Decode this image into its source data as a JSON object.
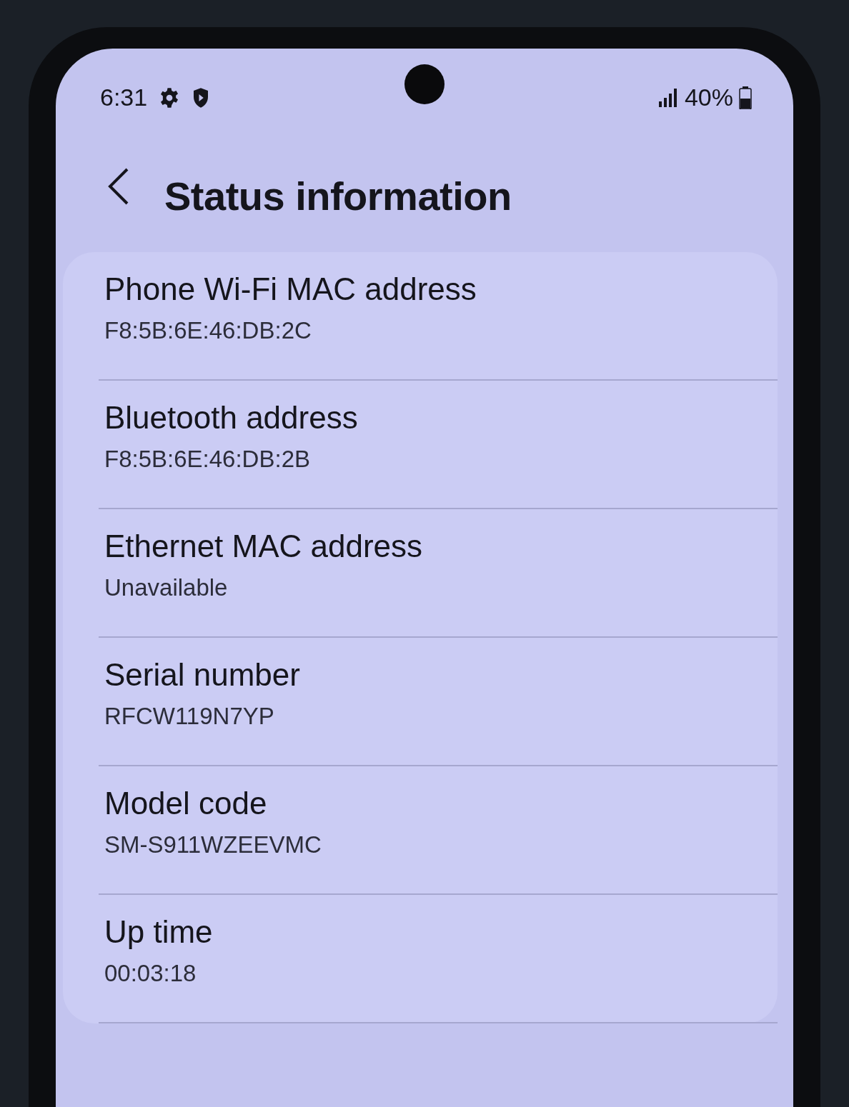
{
  "status_bar": {
    "time": "6:31",
    "battery": "40%"
  },
  "header": {
    "title": "Status information"
  },
  "items": [
    {
      "label": "Phone Wi-Fi MAC address",
      "value": "F8:5B:6E:46:DB:2C"
    },
    {
      "label": "Bluetooth address",
      "value": "F8:5B:6E:46:DB:2B"
    },
    {
      "label": "Ethernet MAC address",
      "value": "Unavailable"
    },
    {
      "label": "Serial number",
      "value": "RFCW119N7YP"
    },
    {
      "label": "Model code",
      "value": "SM-S911WZEEVMC"
    },
    {
      "label": "Up time",
      "value": "00:03:18"
    }
  ]
}
